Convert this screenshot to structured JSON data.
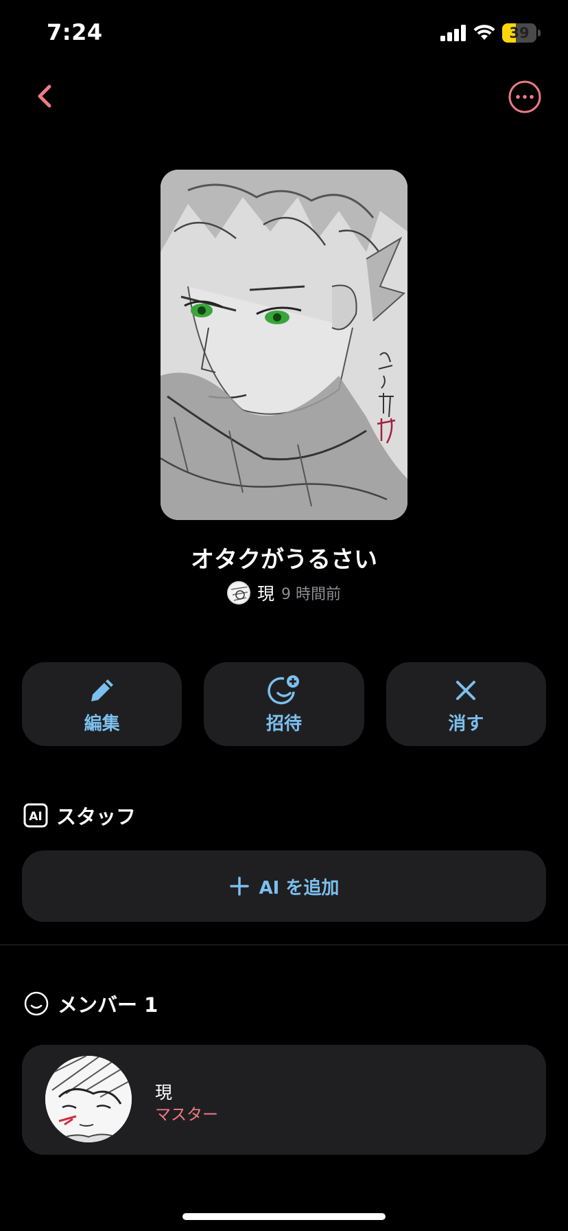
{
  "status_bar": {
    "time": "7:24",
    "battery_level": "39",
    "battery_fraction": 0.39
  },
  "nav": {
    "back_icon": "chevron-left-icon",
    "more_icon": "ellipsis-circle-icon",
    "accent_color": "#ee7b86"
  },
  "room": {
    "title": "オタクがうるさい",
    "owner_name": "現",
    "time_ago": "9 時間前",
    "cover_signature": "糸師 冴"
  },
  "actions": [
    {
      "label": "編集",
      "icon": "pencil-icon"
    },
    {
      "label": "招待",
      "icon": "add-person-icon"
    },
    {
      "label": "消す",
      "icon": "close-icon"
    }
  ],
  "staff_section": {
    "title": "スタッフ",
    "icon": "ai-badge-icon",
    "add_label": "AI を追加",
    "add_icon": "plus-icon"
  },
  "member_section": {
    "title": "メンバー 1",
    "icon": "smile-icon",
    "members": [
      {
        "name": "現",
        "role": "マスター"
      }
    ]
  },
  "colors": {
    "accent_blue": "#7cc0ee",
    "accent_pink": "#ee7b86",
    "card_bg": "#1f1f21",
    "background": "#000000"
  }
}
